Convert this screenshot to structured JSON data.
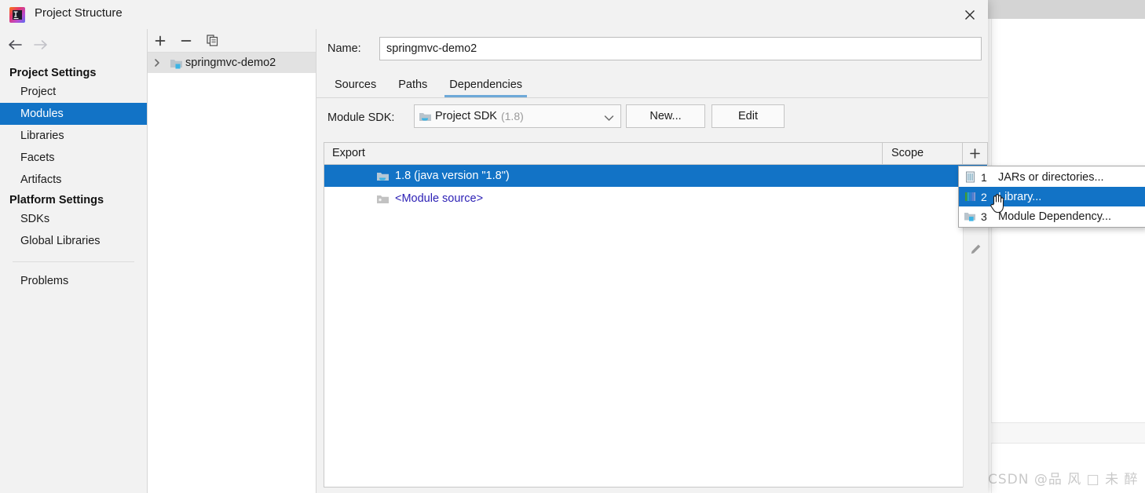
{
  "window": {
    "title": "Project Structure",
    "app_icon": "intellij-idea-icon",
    "close_label": "✕"
  },
  "nav": {
    "back_icon": "arrow-left-icon",
    "forward_icon": "arrow-right-icon",
    "groups": [
      {
        "title": "Project Settings",
        "items": [
          {
            "label": "Project",
            "selected": false
          },
          {
            "label": "Modules",
            "selected": true
          },
          {
            "label": "Libraries",
            "selected": false
          },
          {
            "label": "Facets",
            "selected": false
          },
          {
            "label": "Artifacts",
            "selected": false
          }
        ]
      },
      {
        "title": "Platform Settings",
        "items": [
          {
            "label": "SDKs",
            "selected": false
          },
          {
            "label": "Global Libraries",
            "selected": false
          }
        ]
      }
    ],
    "footer_items": [
      {
        "label": "Problems",
        "selected": false
      }
    ]
  },
  "modules_panel": {
    "toolbar": [
      {
        "name": "add-module-button",
        "glyph": "+"
      },
      {
        "name": "remove-module-button",
        "glyph": "−"
      },
      {
        "name": "copy-module-button",
        "glyph": "copy-icon"
      }
    ],
    "tree": [
      {
        "label": "springmvc-demo2",
        "expand_glyph": "›",
        "icon": "module-folder-icon",
        "selected": true
      }
    ]
  },
  "module_editor": {
    "name_label": "Name:",
    "name_value": "springmvc-demo2",
    "name_placeholder": "",
    "tabs": [
      {
        "label": "Sources",
        "active": false
      },
      {
        "label": "Paths",
        "active": false
      },
      {
        "label": "Dependencies",
        "active": true
      }
    ],
    "sdk_label": "Module SDK:",
    "sdk_value": "Project SDK",
    "sdk_version": "(1.8)",
    "sdk_icon": "jdk-folder-icon",
    "new_button": "New...",
    "edit_button": "Edit"
  },
  "dependencies_table": {
    "columns": [
      "Export",
      "Scope"
    ],
    "add_button_glyph": "+",
    "rows": [
      {
        "icon": "jdk-folder-icon",
        "label": "1.8 (java version \"1.8\")",
        "scope": "",
        "selected": true
      },
      {
        "icon": "module-source-icon",
        "label": "<Module source>",
        "scope": "",
        "selected": false
      }
    ],
    "side_toolbar": [
      {
        "name": "move-down-button",
        "glyph": "▼"
      },
      {
        "name": "edit-pencil-button",
        "glyph": "pencil-icon"
      }
    ]
  },
  "add_menu": {
    "items": [
      {
        "num": "1",
        "label": "JARs or directories...",
        "icon": "jar-file-icon",
        "active": false
      },
      {
        "num": "2",
        "label": "Library...",
        "icon": "library-icon",
        "active": true
      },
      {
        "num": "3",
        "label": "Module Dependency...",
        "icon": "module-dependency-icon",
        "active": false
      }
    ]
  },
  "background": {
    "watermark": "CSDN @品 风 □ 未 醉"
  },
  "colors": {
    "accent": "#1273c6",
    "dialog_bg": "#f2f2f2",
    "tab_underline": "#6ea9d8",
    "link_text": "#2b1fb5"
  }
}
